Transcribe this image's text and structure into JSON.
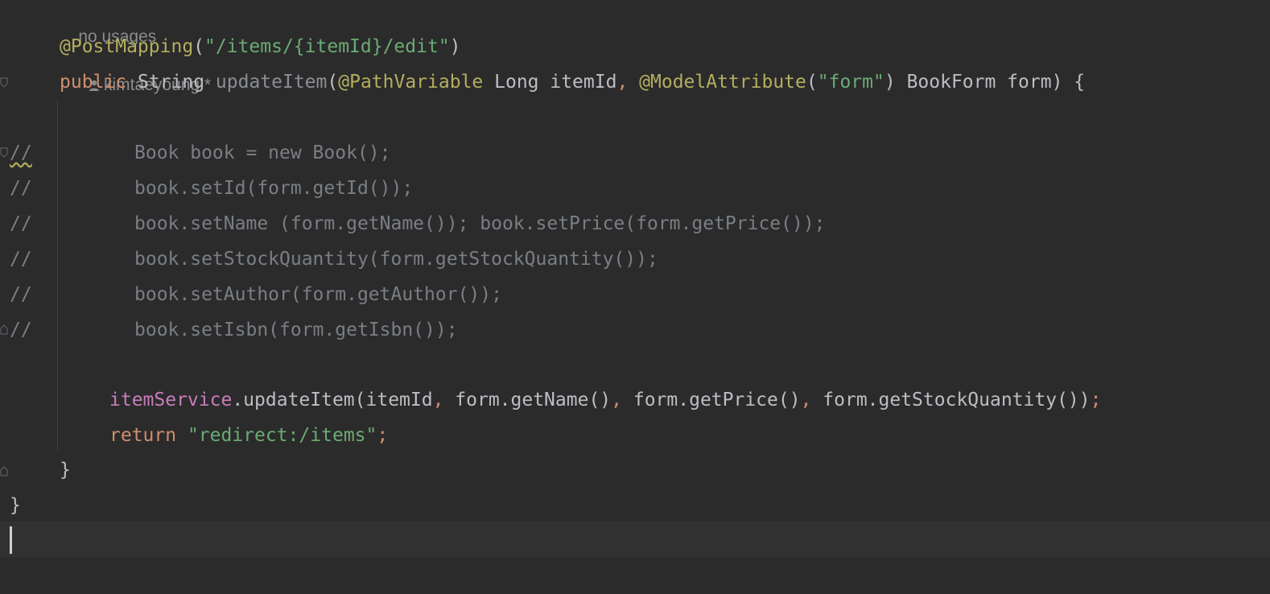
{
  "editor": {
    "inlay_hint": {
      "usages": "no usages",
      "author": "kimtaeyoung *"
    },
    "line1": {
      "annotation": "@PostMapping",
      "open": "(",
      "path": "\"/items/{itemId}/edit\"",
      "close": ")"
    },
    "line2": {
      "kw_public": "public",
      "type_string": "String",
      "method": "updateItem",
      "paren_open": "(",
      "anno_path": "@PathVariable",
      "param1": "Long itemId",
      "comma1": ",",
      "anno_model": "@ModelAttribute",
      "paren2_open": "(",
      "form_str": "\"form\"",
      "paren2_close": ")",
      "param2": "BookForm form",
      "tail": ") {"
    },
    "comment_prefix": "//",
    "commented_lines": [
      "Book book = new Book();",
      "book.setId(form.getId());",
      "book.setName (form.getName()); book.setPrice(form.getPrice());",
      "book.setStockQuantity(form.getStockQuantity());",
      "book.setAuthor(form.getAuthor());",
      "book.setIsbn(form.getIsbn());"
    ],
    "line_service": {
      "field": "itemService",
      "call": ".updateItem(itemId",
      "c1": ",",
      "arg2": " form.getName()",
      "c2": ",",
      "arg3": " form.getPrice()",
      "c3": ",",
      "arg4": " form.getStockQuantity())",
      "semi": ";"
    },
    "line_return": {
      "kw": "return",
      "str": "\"redirect:/items\"",
      "semi": ";"
    },
    "method_close": "}",
    "class_close": "}"
  },
  "colors": {
    "background": "#2b2b2b",
    "keyword": "#cf8e6d",
    "annotation": "#b3ae60",
    "string": "#6aab73",
    "field": "#c77dbb",
    "comment": "#7a7e85",
    "text": "#bcbec4"
  },
  "icons": {
    "author": "person-icon",
    "fold": "fold-marker-icon"
  }
}
